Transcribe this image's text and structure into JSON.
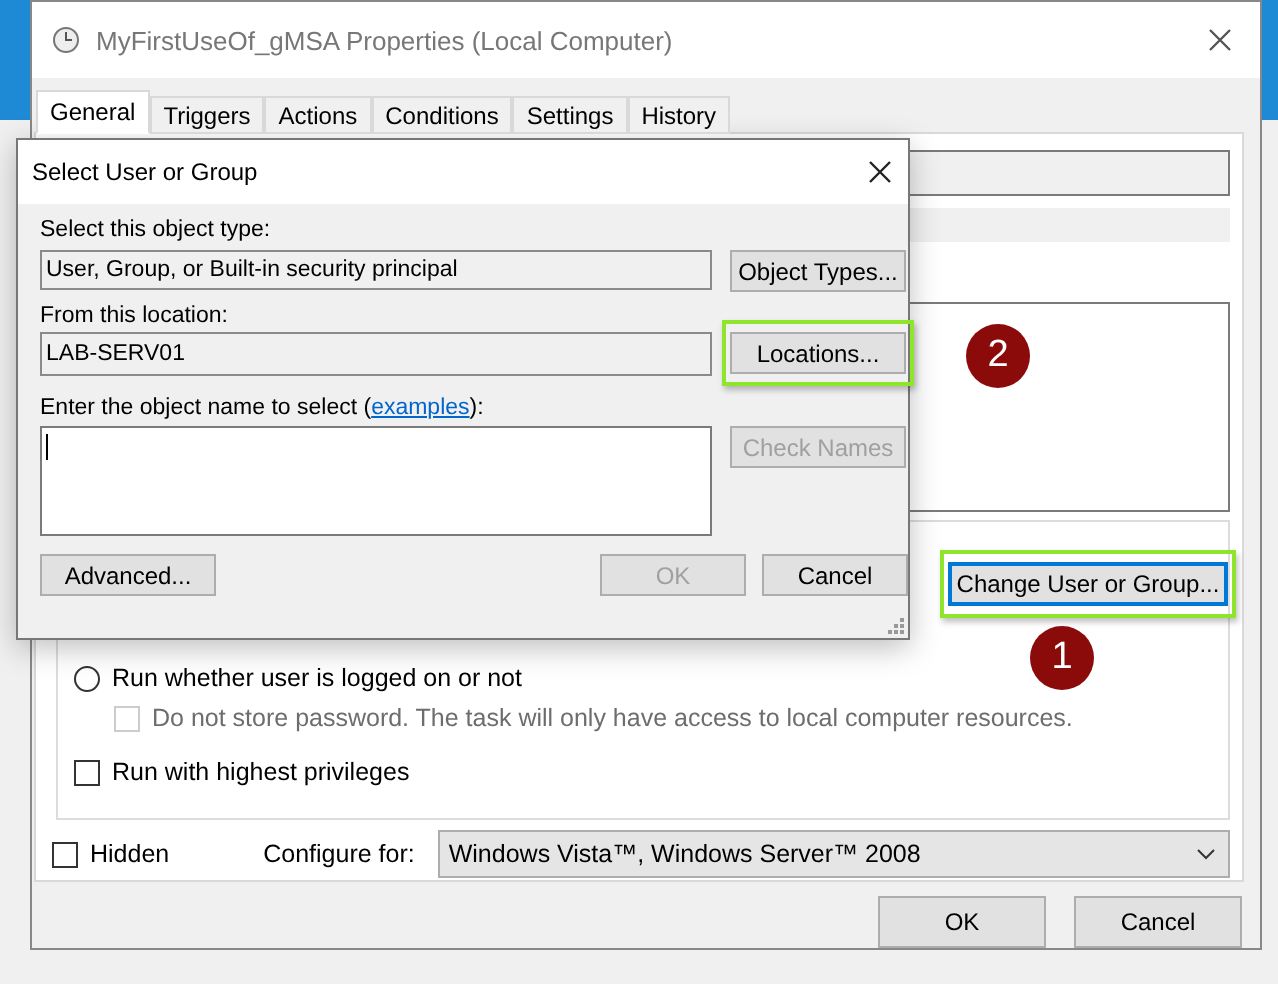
{
  "window": {
    "title": "MyFirstUseOf_gMSA Properties (Local Computer)"
  },
  "tabs": [
    {
      "label": "General",
      "selected": true
    },
    {
      "label": "Triggers",
      "selected": false
    },
    {
      "label": "Actions",
      "selected": false
    },
    {
      "label": "Conditions",
      "selected": false
    },
    {
      "label": "Settings",
      "selected": false
    },
    {
      "label": "History",
      "selected": false
    }
  ],
  "security_options": {
    "change_button": {
      "label": "Change User or Group...",
      "highlighted": true,
      "callout": "1"
    },
    "options": [
      {
        "kind": "radio",
        "label": "Run whether user is logged on or not",
        "checked": false,
        "disabled": false,
        "children": [
          {
            "kind": "checkbox",
            "label": "Do not store password.  The task will only have access to local computer resources.",
            "checked": false,
            "disabled": true
          }
        ]
      },
      {
        "kind": "checkbox",
        "label": "Run with highest privileges",
        "checked": false,
        "disabled": false
      }
    ]
  },
  "hidden": {
    "label": "Hidden",
    "checked": false
  },
  "configure_for": {
    "label": "Configure for:",
    "value": "Windows Vista™, Windows Server™ 2008"
  },
  "buttons": [
    "OK",
    "Cancel"
  ],
  "dialog": {
    "title": "Select User or Group",
    "object_type_label": "Select this object type:",
    "object_type": "User, Group, or Built-in security principal",
    "object_types_button": {
      "label": "Object Types...",
      "highlighted": false
    },
    "location_label": "From this location:",
    "location": "LAB-SERV01",
    "locations_button": {
      "label": "Locations...",
      "highlighted": true,
      "callout": "2"
    },
    "name_label": "Enter the object name to select (",
    "name_link": "examples",
    "name_label_end": "):",
    "check_names_button": {
      "label": "Check Names",
      "disabled": true
    },
    "advanced_button": "Advanced...",
    "ok_button": {
      "label": "OK",
      "disabled": true
    },
    "cancel_button": "Cancel"
  }
}
